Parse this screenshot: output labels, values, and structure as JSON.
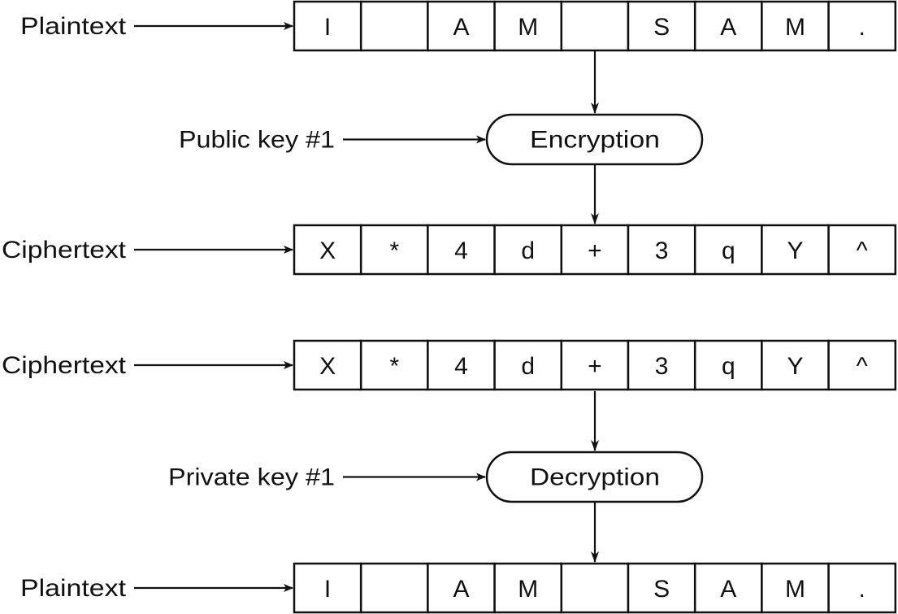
{
  "colors": {
    "stroke": "#111111",
    "background": "#ffffff"
  },
  "rows": [
    {
      "label": "Plaintext",
      "cells": [
        "I",
        "",
        "A",
        "M",
        "",
        "S",
        "A",
        "M",
        "."
      ]
    },
    {
      "label": "Ciphertext",
      "cells": [
        "X",
        "*",
        "4",
        "d",
        "+",
        "3",
        "q",
        "Y",
        "^"
      ]
    },
    {
      "label": "Ciphertext",
      "cells": [
        "X",
        "*",
        "4",
        "d",
        "+",
        "3",
        "q",
        "Y",
        "^"
      ]
    },
    {
      "label": "Plaintext",
      "cells": [
        "I",
        "",
        "A",
        "M",
        "",
        "S",
        "A",
        "M",
        "."
      ]
    }
  ],
  "processes": [
    {
      "name": "Encryption",
      "key_label": "Public key #1"
    },
    {
      "name": "Decryption",
      "key_label": "Private key #1"
    }
  ]
}
